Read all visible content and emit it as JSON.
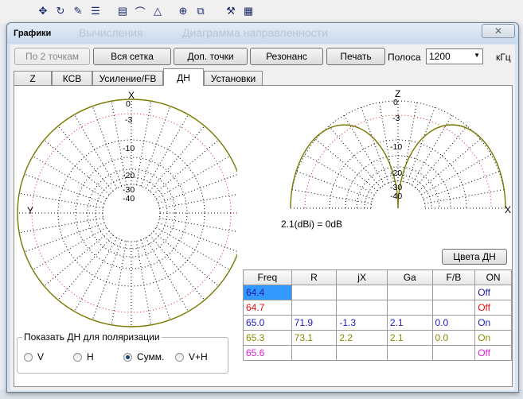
{
  "app_toolbar": {
    "icons": [
      "move-icon",
      "rotate-icon",
      "edit-icon",
      "wire-settings-icon",
      "document-icon",
      "draw-icon",
      "triangle-icon",
      "crosshair-icon",
      "copy-icon",
      "tools-icon",
      "calculator-icon"
    ]
  },
  "window": {
    "title": "Графики",
    "close_label": "✕",
    "background_ghost": [
      "Вычисления",
      "Диаграмма направленности"
    ]
  },
  "toolbar": {
    "btn_two_points": "По 2 точкам",
    "btn_full_grid": "Вся сетка",
    "btn_extra_points": "Доп. точки",
    "btn_resonance": "Резонанс",
    "btn_print": "Печать",
    "band_label": "Полоса",
    "band_value": "1200",
    "band_unit": "кГц"
  },
  "tabs": [
    {
      "label": "Z"
    },
    {
      "label": "КСВ"
    },
    {
      "label": "Усиление/FB"
    },
    {
      "label": "ДН"
    },
    {
      "label": "Установки"
    }
  ],
  "pattern": {
    "horizontal": {
      "axis_top": "X",
      "axis_left": "Y",
      "rings": [
        "0",
        "-3",
        "-10",
        "-20",
        "-30",
        "-40"
      ]
    },
    "vertical": {
      "axis_top": "Z",
      "axis_right": "X",
      "rings": [
        "0",
        "-3",
        "-10",
        "-20",
        "-30",
        "-40"
      ]
    },
    "reference": "2.1(dBi) = 0dB",
    "colors_button": "Цвета ДН",
    "trace_color": "#7a7a00"
  },
  "table": {
    "headers": [
      "Freq",
      "R",
      "jX",
      "Ga",
      "F/B",
      "ON"
    ],
    "rows": [
      {
        "freq": "64.4",
        "r": "",
        "jx": "",
        "ga": "",
        "fb": "",
        "on": "Off",
        "color": "#1a1aa0",
        "selected": true
      },
      {
        "freq": "64.7",
        "r": "",
        "jx": "",
        "ga": "",
        "fb": "",
        "on": "Off",
        "color": "#e01010",
        "selected": false
      },
      {
        "freq": "65.0",
        "r": "71.9",
        "jx": "-1.3",
        "ga": "2.1",
        "fb": "0.0",
        "on": "On",
        "color": "#1a1ac8",
        "selected": false
      },
      {
        "freq": "65.3",
        "r": "73.1",
        "jx": "2.2",
        "ga": "2.1",
        "fb": "0.0",
        "on": "On",
        "color": "#8a8a00",
        "selected": false
      },
      {
        "freq": "65.6",
        "r": "",
        "jx": "",
        "ga": "",
        "fb": "",
        "on": "Off",
        "color": "#e020e0",
        "selected": false
      }
    ]
  },
  "polarization": {
    "title": "Показать ДН для поляризации",
    "options": [
      {
        "label": "V",
        "checked": false
      },
      {
        "label": "H",
        "checked": false
      },
      {
        "label": "Сумм.",
        "checked": true
      },
      {
        "label": "V+H",
        "checked": false
      }
    ]
  }
}
